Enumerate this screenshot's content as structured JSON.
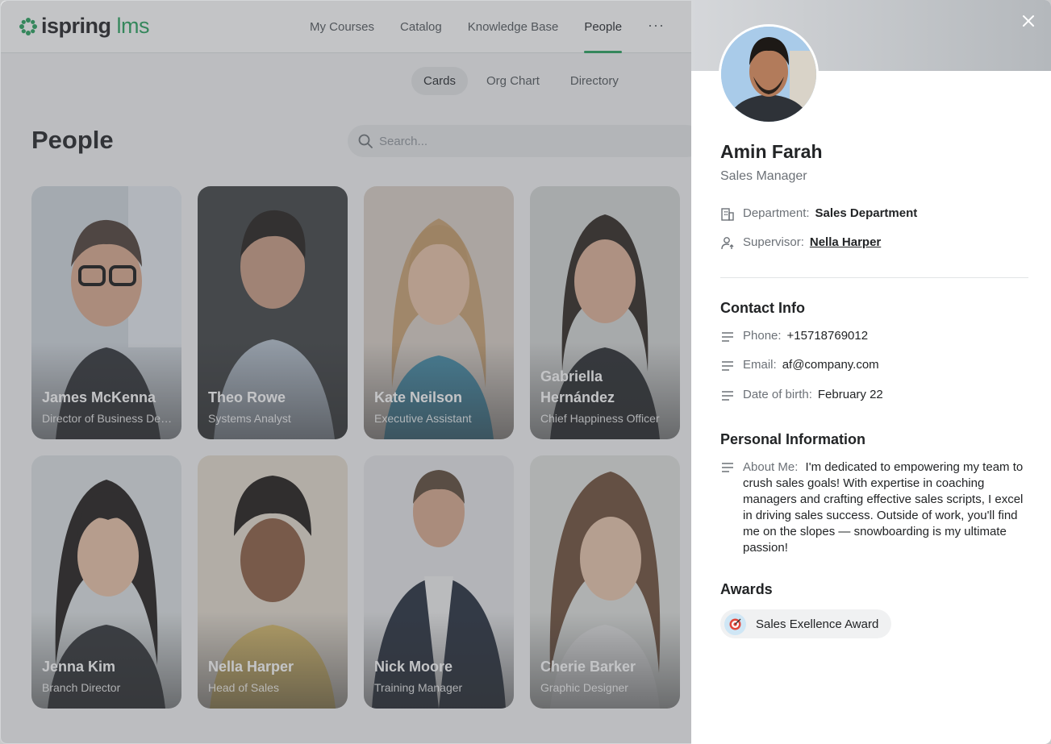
{
  "header": {
    "logo_main": "ispring",
    "logo_accent": "lms",
    "nav": [
      "My Courses",
      "Catalog",
      "Knowledge Base",
      "People"
    ],
    "active_nav": "People",
    "more_label": "···"
  },
  "subtabs": [
    "Cards",
    "Org Chart",
    "Directory"
  ],
  "page_title": "People",
  "search": {
    "placeholder": "Search..."
  },
  "cards": [
    {
      "name": "James McKenna",
      "role": "Director of Business Development"
    },
    {
      "name": "Theo Rowe",
      "role": "Systems Analyst"
    },
    {
      "name": "Kate Neilson",
      "role": "Executive Assistant"
    },
    {
      "name": "Gabriella Hernández",
      "role": "Chief Happiness Officer"
    },
    {
      "name": "Jenna Kim",
      "role": "Branch Director"
    },
    {
      "name": "Nella Harper",
      "role": "Head of Sales"
    },
    {
      "name": "Nick Moore",
      "role": "Training Manager"
    },
    {
      "name": "Cherie Barker",
      "role": "Graphic Designer"
    }
  ],
  "profile": {
    "name": "Amin Farah",
    "title": "Sales Manager",
    "department_label": "Department:",
    "department": "Sales Department",
    "supervisor_label": "Supervisor:",
    "supervisor": "Nella Harper",
    "contact_title": "Contact Info",
    "phone_label": "Phone:",
    "phone": "+15718769012",
    "email_label": "Email:",
    "email": "af@company.com",
    "dob_label": "Date of birth:",
    "dob": "February 22",
    "personal_title": "Personal Information",
    "about_label": "About Me:",
    "about": "I'm dedicated to empowering my team to crush sales goals! With expertise in coaching managers and crafting effective sales scripts, I excel in driving sales success. Outside of work, you'll find me on the slopes — snowboarding is my ultimate passion!",
    "awards_title": "Awards",
    "award": "Sales Exellence Award"
  },
  "colors": {
    "accent": "#22a05a",
    "overlay": "#5a5c60"
  }
}
